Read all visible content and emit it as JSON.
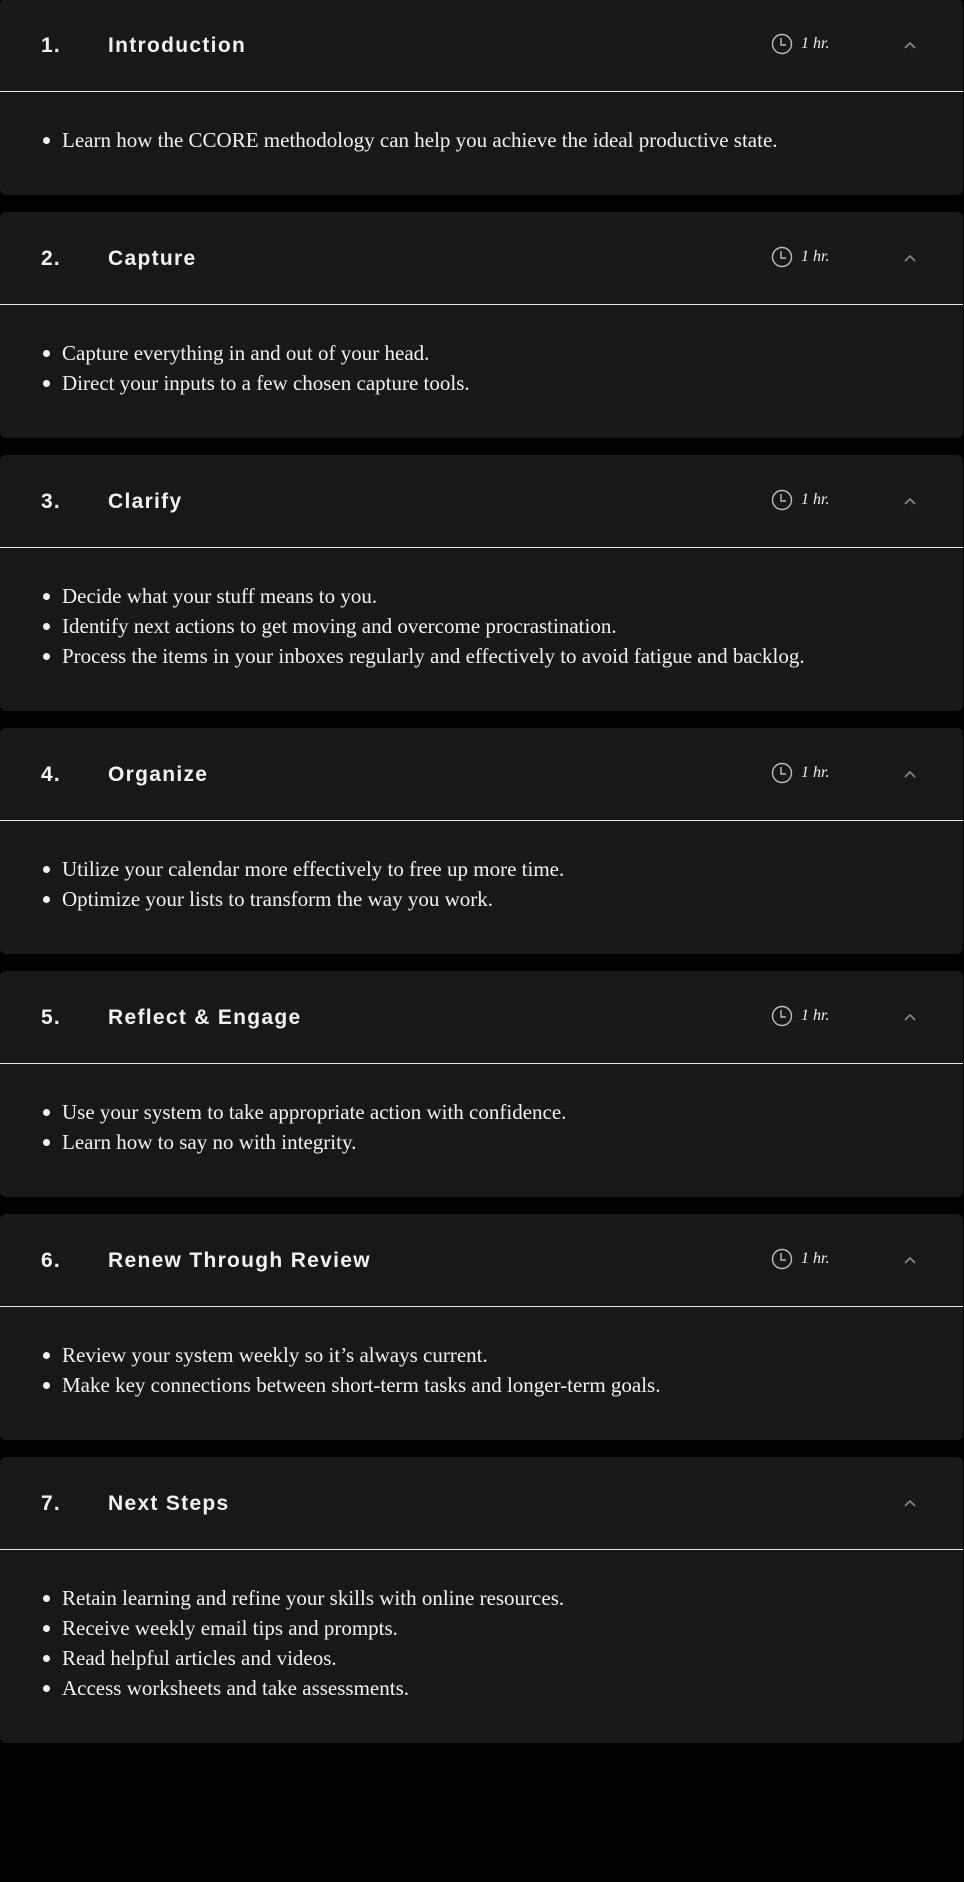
{
  "colors": {
    "page_bg": "#000000",
    "panel_bg": "#181818",
    "text": "#f2f2f2",
    "divider": "#e8e8e8",
    "icon": "#bdbdbd"
  },
  "modules": [
    {
      "number": "1.",
      "title": "Introduction",
      "duration": "1 hr.",
      "icon": "clock-icon",
      "expanded": true,
      "bullets": [
        "Learn how the CCORE methodology can help you achieve the ideal productive state."
      ]
    },
    {
      "number": "2.",
      "title": "Capture",
      "duration": "1 hr.",
      "icon": "clock-icon",
      "expanded": true,
      "bullets": [
        "Capture everything in and out of your head.",
        "Direct your inputs to a few chosen capture tools."
      ]
    },
    {
      "number": "3.",
      "title": "Clarify",
      "duration": "1 hr.",
      "icon": "clock-icon",
      "expanded": true,
      "bullets": [
        "Decide what your stuff means to you.",
        "Identify next actions to get moving and overcome procrastination.",
        "Process the items in your inboxes regularly and effectively to avoid fatigue and backlog."
      ]
    },
    {
      "number": "4.",
      "title": "Organize",
      "duration": "1 hr.",
      "icon": "clock-icon",
      "expanded": true,
      "bullets": [
        "Utilize your calendar more effectively to free up more time.",
        "Optimize your lists to transform the way you work."
      ]
    },
    {
      "number": "5.",
      "title": "Reflect & Engage",
      "duration": "1 hr.",
      "icon": "clock-icon",
      "expanded": true,
      "bullets": [
        "Use your system to take appropriate action with confidence.",
        "Learn how to say no with integrity."
      ]
    },
    {
      "number": "6.",
      "title": "Renew Through Review",
      "duration": "1 hr.",
      "icon": "clock-icon",
      "expanded": true,
      "bullets": [
        "Review your system weekly so it’s always current.",
        "Make key connections between short-term tasks and longer-term goals."
      ]
    },
    {
      "number": "7.",
      "title": "Next Steps",
      "duration": null,
      "expanded": true,
      "bullets": [
        "Retain learning and refine your skills with online resources.",
        "Receive weekly email tips and prompts.",
        "Read helpful articles and videos.",
        "Access worksheets and take assessments."
      ]
    }
  ]
}
